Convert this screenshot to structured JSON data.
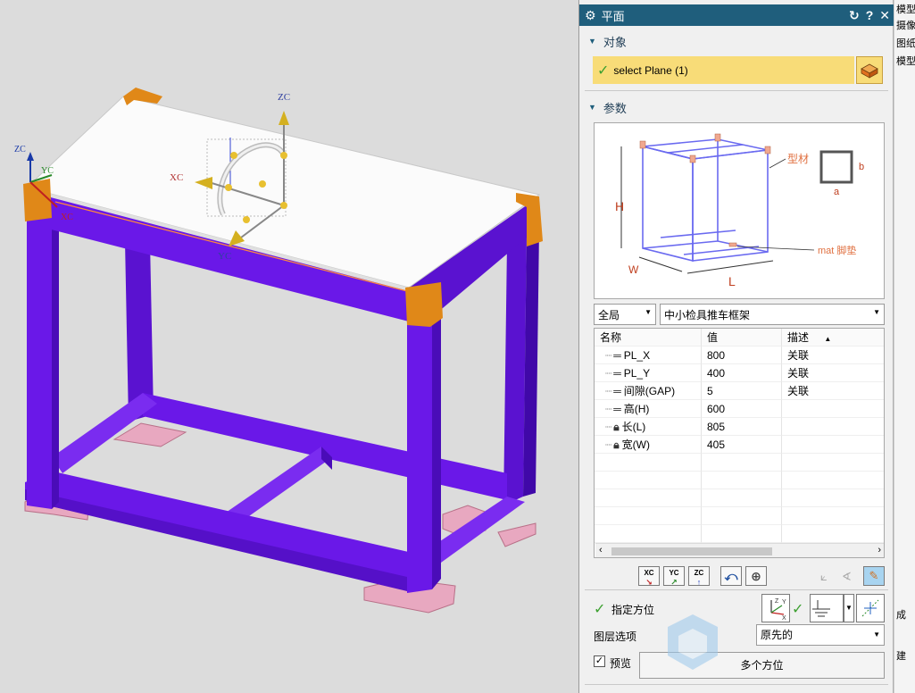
{
  "viewport": {
    "axis_labels": [
      "ZC",
      "XC",
      "YC"
    ],
    "triad_labels": [
      "ZC",
      "XC",
      "YC"
    ]
  },
  "dialog": {
    "title": "平面",
    "header_icons": [
      "gear-icon",
      "reset-icon",
      "help-icon",
      "close-icon"
    ],
    "help_glyph": "?",
    "close_glyph": "✕",
    "section_object": "对象",
    "selection_text": "select Plane (1)",
    "section_params": "参数",
    "diagram_labels": {
      "profile": "型材",
      "a": "a",
      "b": "b",
      "H": "H",
      "W": "W",
      "L": "L",
      "mat": "mat 脚垫"
    },
    "scope_select": "全局",
    "template_select": "中小检具推车框架",
    "table": {
      "headers": [
        "名称",
        "值",
        "描述"
      ],
      "rows": [
        {
          "name": "PL_X",
          "value": "800",
          "desc": "关联",
          "icon": "equals-icon"
        },
        {
          "name": "PL_Y",
          "value": "400",
          "desc": "关联",
          "icon": "equals-icon"
        },
        {
          "name": "间隙(GAP)",
          "value": "5",
          "desc": "关联",
          "icon": "equals-icon"
        },
        {
          "name": "高(H)",
          "value": "600",
          "desc": "",
          "icon": "equals-icon"
        },
        {
          "name": "长(L)",
          "value": "805",
          "desc": "",
          "icon": "lock-icon"
        },
        {
          "name": "宽(W)",
          "value": "405",
          "desc": "",
          "icon": "lock-icon"
        }
      ]
    },
    "toolbar_labels": [
      "XC",
      "YC",
      "ZC"
    ],
    "orientation_label": "指定方位",
    "layer_label": "图层选项",
    "layer_value": "原先的",
    "preview_label": "预览",
    "multi_orient_label": "多个方位"
  },
  "right_panel": {
    "items": [
      "模型视图",
      "摄像",
      "图纸",
      "模型",
      "成",
      "建"
    ]
  },
  "colors": {
    "frame": "#6a18e8",
    "title_bar": "#1f5e7c",
    "selection_bg": "#f8dc78",
    "corner_caps": "#e08818",
    "feet": "#e8a8c0"
  }
}
